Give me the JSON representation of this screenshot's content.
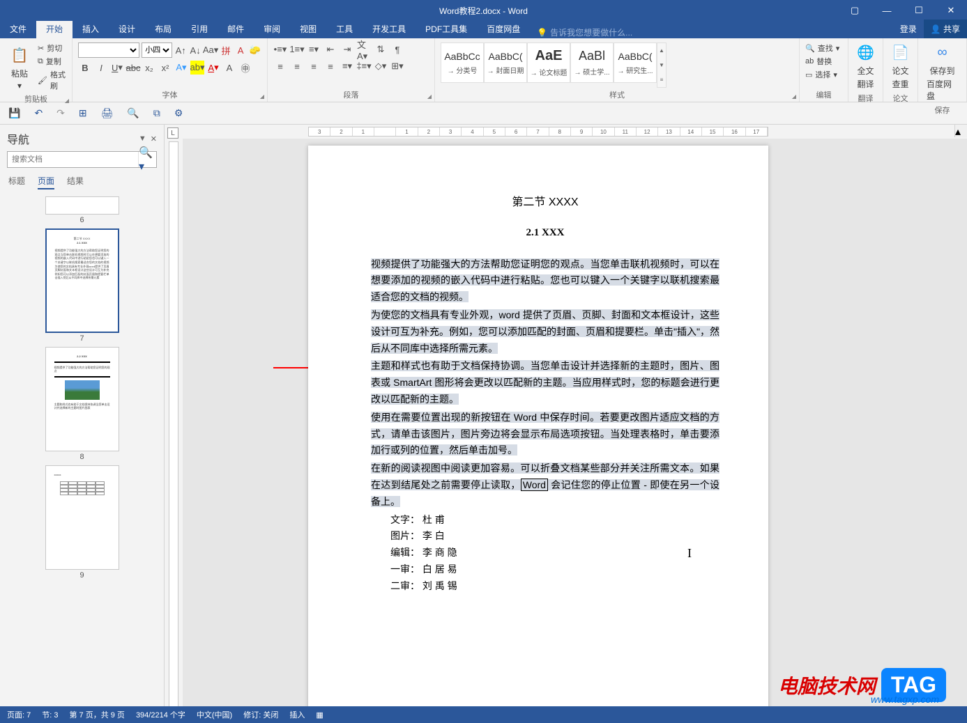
{
  "title": "Word教程2.docx - Word",
  "window_controls": {
    "ribbon_opts": "▢",
    "min": "—",
    "max": "☐",
    "close": "✕"
  },
  "account": {
    "login": "登录",
    "share": "共享"
  },
  "tabs": {
    "file": "文件",
    "home": "开始",
    "insert": "插入",
    "design": "设计",
    "layout": "布局",
    "references": "引用",
    "mailings": "邮件",
    "review": "审阅",
    "view": "视图",
    "tools": "工具",
    "developer": "开发工具",
    "pdf": "PDF工具集",
    "baidu": "百度网盘",
    "tell": "告诉我您想要做什么..."
  },
  "groups": {
    "clipboard": {
      "label": "剪贴板",
      "paste": "粘贴",
      "cut": "剪切",
      "copy": "复制",
      "painter": "格式刷"
    },
    "font": {
      "label": "字体",
      "size": "小四"
    },
    "paragraph": {
      "label": "段落"
    },
    "styles": {
      "label": "样式",
      "items": [
        {
          "prev": "AaBbCc",
          "name": "→ 分类号"
        },
        {
          "prev": "AaBbC(",
          "name": "→ 封面日期"
        },
        {
          "prev": "AaE",
          "name": "→ 论文标题"
        },
        {
          "prev": "AaBl",
          "name": "→ 硕士学..."
        },
        {
          "prev": "AaBbC(",
          "name": "→ 研究生..."
        }
      ]
    },
    "editing": {
      "label": "编辑",
      "find": "查找",
      "replace": "替换",
      "select": "选择"
    },
    "translate": {
      "label": "翻译",
      "full": "全文",
      "sub": "翻译"
    },
    "thesis": {
      "label": "论文",
      "check": "论文",
      "sub": "查重"
    },
    "save": {
      "label": "保存",
      "btn": "保存到",
      "sub": "百度网盘"
    }
  },
  "qat": {
    "save": "💾",
    "undo": "↶",
    "redo": "↷"
  },
  "nav": {
    "title": "导航",
    "search_placeholder": "搜索文档",
    "tabs": {
      "headings": "标题",
      "pages": "页面",
      "results": "结果"
    },
    "pages": [
      {
        "n": "6"
      },
      {
        "n": "7"
      },
      {
        "n": "8"
      },
      {
        "n": "9"
      }
    ]
  },
  "document": {
    "h3": "第二节  XXXX",
    "h4": "2.1 XXX",
    "p1": "视频提供了功能强大的方法帮助您证明您的观点。当您单击联机视频时，可以在想要添加的视频的嵌入代码中进行粘贴。您也可以键入一个关键字以联机搜索最适合您的文档的视频。",
    "p2": "为使您的文档具有专业外观，word 提供了页眉、页脚、封面和文本框设计，这些设计可互为补充。例如，您可以添加匹配的封面、页眉和提要栏。单击\"插入\"，然后从不同库中选择所需元素。",
    "p3": "主题和样式也有助于文档保持协调。当您单击设计并选择新的主题时，图片、图表或 SmartArt 图形将会更改以匹配新的主题。当应用样式时，您的标题会进行更改以匹配新的主题。",
    "p4": "使用在需要位置出现的新按钮在 Word 中保存时间。若要更改图片适应文档的方式，请单击该图片，图片旁边将会显示布局选项按钮。当处理表格时，单击要添加行或列的位置，然后单击加号。",
    "p5a": "在新的阅读视图中阅读更加容易。可以折叠文档某些部分并关注所需文本。如果在达到结尾处之前需要停止读取，",
    "p5b": "Word",
    "p5c": " 会记住您的停止位置 - 即使在另一个设备上。",
    "credits": [
      "文字：  杜     甫",
      "图片：  李     白",
      "编辑：  李  商  隐",
      "一审：  白  居  易",
      "二审：  刘  禹  锡"
    ]
  },
  "status": {
    "page": "页面: 7",
    "section": "节: 3",
    "pages": "第 7 页，共 9 页",
    "words": "394/2214 个字",
    "lang": "中文(中国)",
    "track": "修订: 关闭",
    "insert": "插入"
  },
  "watermark": {
    "red": "电脑技术网",
    "tag": "TAG",
    "url": "www.tagxp.com"
  }
}
